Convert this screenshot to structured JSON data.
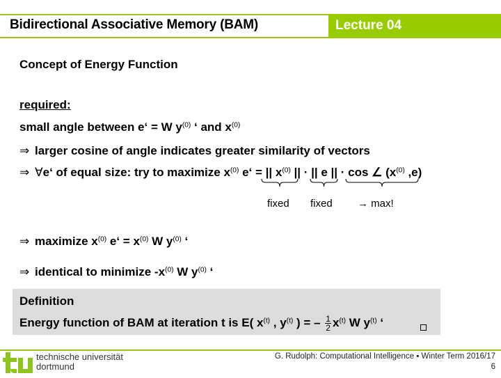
{
  "header": {
    "title": "Bidirectional Associative Memory (BAM)",
    "lecture": "Lecture 04",
    "accent_color": "#99cc00"
  },
  "slide": {
    "heading": "Concept of Energy Function",
    "required_label": "required:",
    "line1": {
      "pre": "small angle between e‘ = W y",
      "sup1": "(0)",
      "mid": " ‘ and x",
      "sup2": "(0)"
    },
    "line2": {
      "arrow": "⇒",
      "text": "larger cosine of angle indicates greater similarity of vectors"
    },
    "line3": {
      "arrow": "⇒",
      "forall": "∀",
      "a": "e‘ of equal size: try to maximize x",
      "sup1": "(0)",
      "b": " e‘ = || x",
      "sup2": "(0)",
      "c": " || · || e || · cos ∠ (x",
      "sup3": "(0)",
      "d": " ,e)"
    },
    "brace_labels": [
      "fixed",
      "fixed",
      "→ max!"
    ],
    "line4": {
      "arrow": "⇒",
      "a": "maximize x",
      "sup1": "(0)",
      "b": " e‘ = x",
      "sup2": "(0)",
      "c": " W y",
      "sup3": "(0)",
      "d": " ‘"
    },
    "line5": {
      "arrow": "⇒",
      "a": "identical to minimize  -x",
      "sup1": "(0)",
      "b": " W y",
      "sup2": "(0)",
      "c": " ‘"
    },
    "definition": {
      "title": "Definition",
      "a": "Energy function of BAM at iteration t is E( x",
      "sup1": "(t)",
      "b": " , y",
      "sup2": "(t)",
      "c": " ) = –",
      "frac_num": "1",
      "frac_den": "2",
      "d": "x",
      "sup3": "(t)",
      "e": " W y",
      "sup4": "(t)",
      "f": " ‘",
      "qed_icon": "square"
    }
  },
  "footer": {
    "university_line1": "technische universität",
    "university_line2": "dortmund",
    "credit": "G. Rudolph: Computational Intelligence ▪ Winter Term 2016/17",
    "page": "6"
  }
}
